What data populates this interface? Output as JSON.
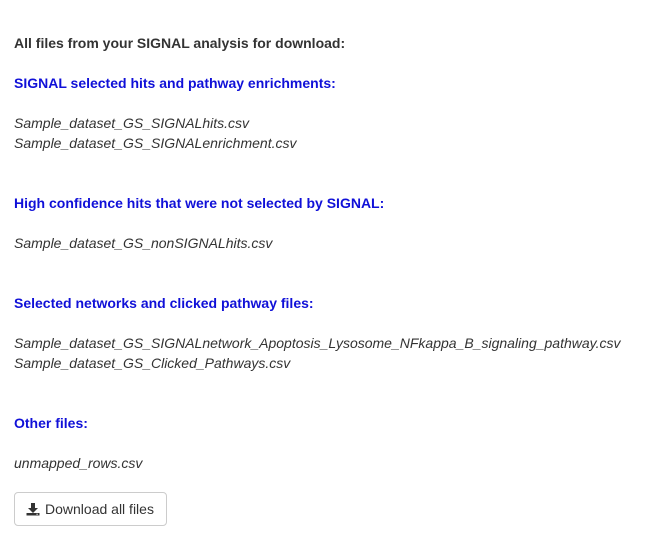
{
  "intro": "All files from your SIGNAL analysis for download:",
  "sections": [
    {
      "heading": "SIGNAL selected hits and pathway enrichments:",
      "files": [
        "Sample_dataset_GS_SIGNALhits.csv",
        "Sample_dataset_GS_SIGNALenrichment.csv"
      ]
    },
    {
      "heading": "High confidence hits that were not selected by SIGNAL:",
      "files": [
        "Sample_dataset_GS_nonSIGNALhits.csv"
      ]
    },
    {
      "heading": "Selected networks and clicked pathway files:",
      "files": [
        "Sample_dataset_GS_SIGNALnetwork_Apoptosis_Lysosome_NFkappa_B_signaling_pathway.csv",
        "Sample_dataset_GS_Clicked_Pathways.csv"
      ]
    },
    {
      "heading": "Other files:",
      "files": [
        "unmapped_rows.csv"
      ]
    }
  ],
  "download_button": {
    "label": "Download all files",
    "icon": "download-icon"
  }
}
